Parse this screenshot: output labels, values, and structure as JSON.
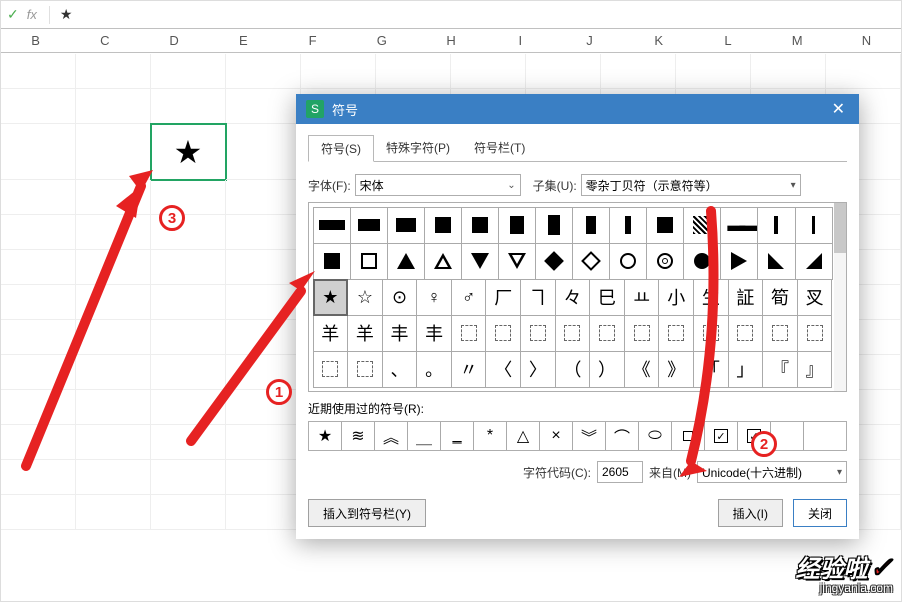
{
  "formula_bar": {
    "content": "★"
  },
  "columns": [
    "B",
    "C",
    "D",
    "E",
    "F",
    "G",
    "H",
    "I",
    "J",
    "K",
    "L",
    "M",
    "N"
  ],
  "active_cell_value": "★",
  "dialog": {
    "title": "符号",
    "tabs": {
      "symbols": "符号(S)",
      "special": "特殊字符(P)",
      "bar": "符号栏(T)"
    },
    "labels": {
      "font": "字体(F):",
      "subset": "子集(U):",
      "recent": "近期使用过的符号(R):",
      "code": "字符代码(C):",
      "from": "来自(M)"
    },
    "font_value": "宋体",
    "subset_value": "零杂丁贝符（示意符等）",
    "code_value": "2605",
    "from_value": "Unicode(十六进制)",
    "buttons": {
      "togglebar": "插入到符号栏(Y)",
      "insert": "插入(I)",
      "close": "关闭"
    },
    "recent": [
      "★",
      "≋",
      "︽",
      "＿",
      "‗",
      "*",
      "△",
      "×",
      "︾",
      "⌒",
      "⬭",
      "□",
      "☑",
      "☑",
      "",
      ""
    ]
  },
  "annotations": {
    "n1": "1",
    "n2": "2",
    "n3": "3"
  },
  "watermark": {
    "top": "经验啦",
    "sub": "jingyanla.com"
  }
}
